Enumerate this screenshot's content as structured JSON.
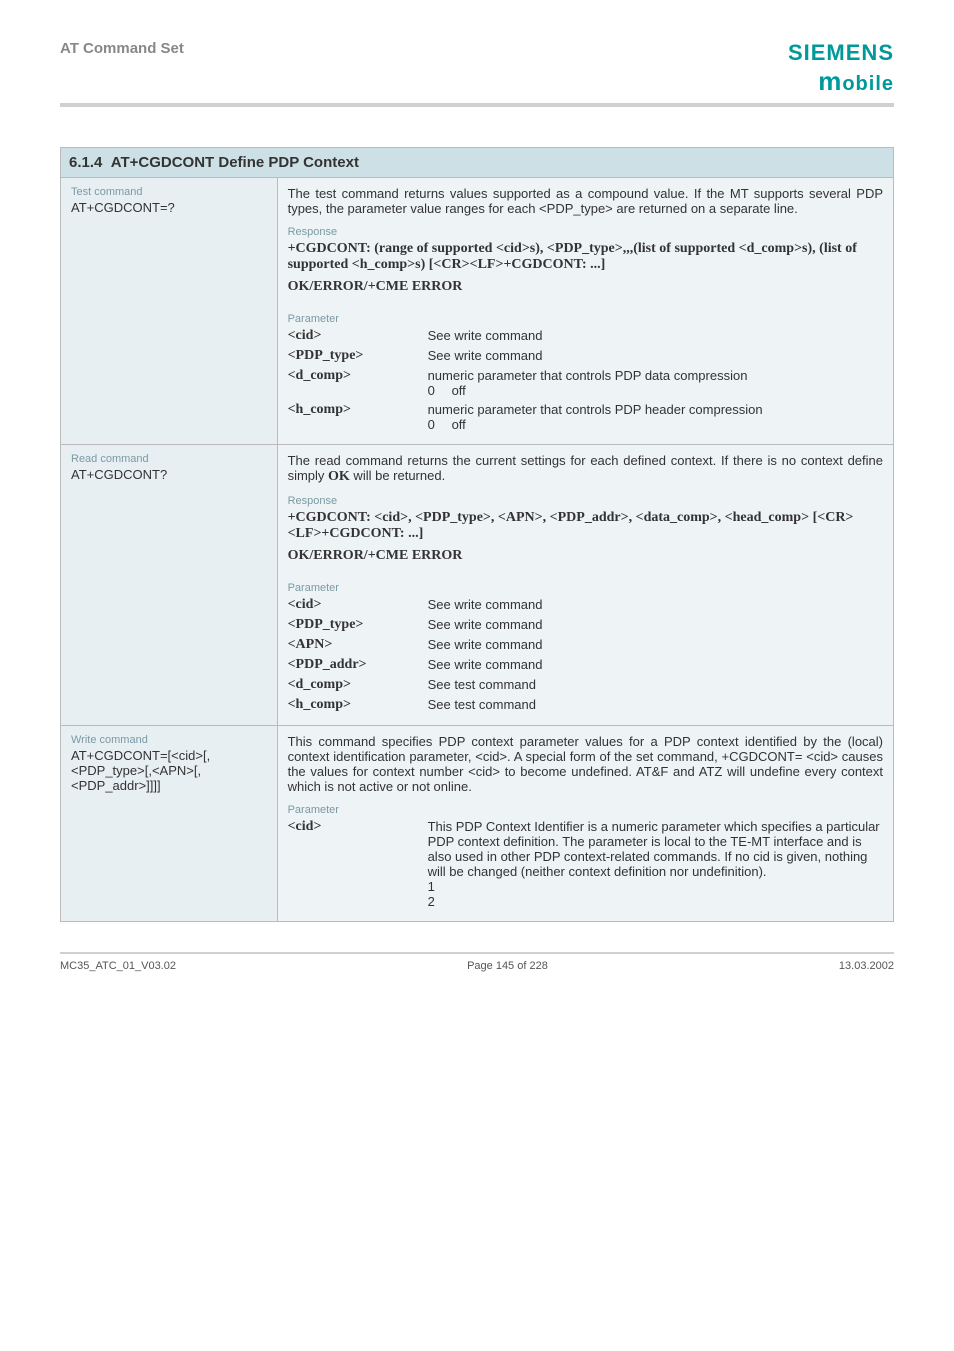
{
  "header": {
    "title": "AT Command Set",
    "logo_top": "SIEMENS",
    "logo_bottom": "obile",
    "logo_m": "m"
  },
  "section": {
    "number": "6.1.4",
    "title": "AT+CGDCONT  Define PDP Context"
  },
  "test": {
    "label": "Test command",
    "cmd": "AT+CGDCONT=?",
    "desc": "The test command returns values supported as a compound value. If the MT supports several PDP types, the parameter value ranges for each <PDP_type> are returned on a separate line.",
    "resp_label": "Response",
    "resp_line1": "+CGDCONT:  (range of supported <cid>s), <PDP_type>,,,(list of supported <d_comp>s), (list of supported <h_comp>s) [<CR><LF>+CGDCONT: ...]",
    "ok": "OK/ERROR/+CME ERROR",
    "param_label": "Parameter",
    "params": {
      "cid": {
        "name": "<cid>",
        "desc": "See write command"
      },
      "pdp_type": {
        "name": "<PDP_type>",
        "desc": "See write command"
      },
      "d_comp": {
        "name": "<d_comp>",
        "desc": "numeric parameter that controls PDP data compression",
        "v0": "0",
        "v0d": "off"
      },
      "h_comp": {
        "name": "<h_comp>",
        "desc": "numeric parameter that controls PDP header compression",
        "v0": "0",
        "v0d": "off"
      }
    }
  },
  "read": {
    "label": "Read command",
    "cmd": "AT+CGDCONT?",
    "desc_a": "The read command returns the current settings for each defined context. If there is no context define simply ",
    "desc_ok": "OK",
    "desc_b": " will be returned.",
    "resp_label": "Response",
    "resp_line": "+CGDCONT: <cid>, <PDP_type>, <APN>, <PDP_addr>, <data_comp>, <head_comp> [<CR><LF>+CGDCONT: ...]",
    "ok": "OK/ERROR/+CME ERROR",
    "param_label": "Parameter",
    "params": {
      "cid": {
        "name": "<cid>",
        "desc": "See write command"
      },
      "pdp_type": {
        "name": "<PDP_type>",
        "desc": "See write command"
      },
      "apn": {
        "name": "<APN>",
        "desc": "See write command"
      },
      "pdp_addr": {
        "name": "<PDP_addr>",
        "desc": "See write command"
      },
      "d_comp": {
        "name": "<d_comp>",
        "desc": "See test command"
      },
      "h_comp": {
        "name": "<h_comp>",
        "desc": "See test command"
      }
    }
  },
  "write": {
    "label": "Write command",
    "cmd": "AT+CGDCONT=[<cid>[,<PDP_type>[,<APN>[,<PDP_addr>]]]]",
    "desc": "This command specifies PDP context parameter values for a PDP context identified by the (local) context identification parameter, <cid>. A special form of the set command, +CGDCONT= <cid> causes the values for context number <cid> to become undefined. AT&F and ATZ will undefine every context which is not active or not online.",
    "param_label": "Parameter",
    "params": {
      "cid": {
        "name": "<cid>",
        "desc": "This PDP Context Identifier is a numeric parameter which specifies a particular PDP context definition. The parameter is local to the TE-MT interface and is also used in other PDP context-related commands. If no cid is given, nothing will be changed (neither context definition nor undefinition).",
        "v1": "1",
        "v2": "2"
      }
    }
  },
  "footer": {
    "left": "MC35_ATC_01_V03.02",
    "center": "Page 145 of 228",
    "right": "13.03.2002"
  }
}
